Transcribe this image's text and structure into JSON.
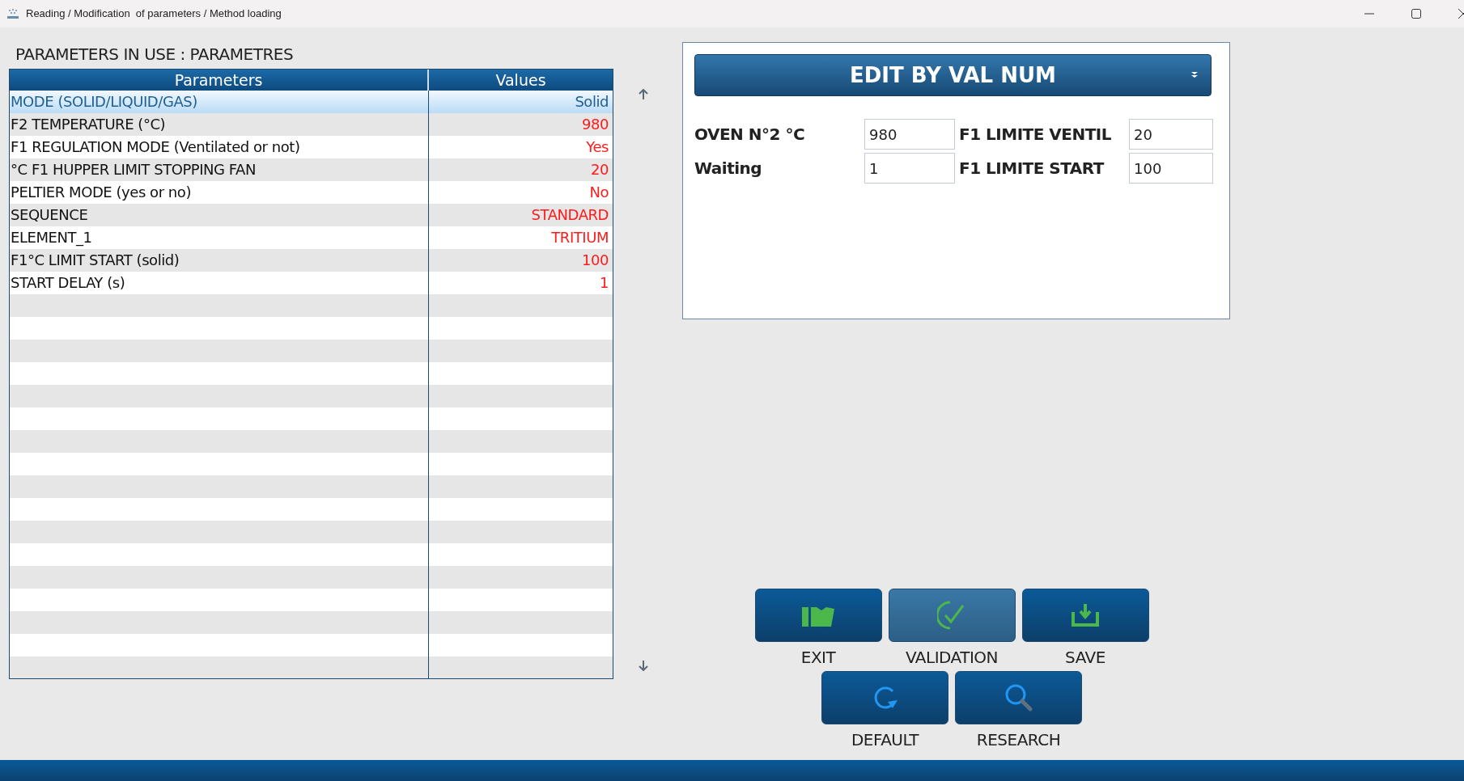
{
  "window": {
    "title": "Reading / Modification  of parameters / Method loading"
  },
  "heading": "PARAMETERS IN USE : PARAMETRES",
  "table": {
    "columns": [
      "Parameters",
      "Values"
    ],
    "rows": [
      {
        "parameter": "MODE (SOLID/LIQUID/GAS)",
        "value": "Solid",
        "selected": true
      },
      {
        "parameter": "F2 TEMPERATURE (°C)",
        "value": "980",
        "selected": false
      },
      {
        "parameter": "F1 REGULATION MODE (Ventilated or not)",
        "value": "Yes",
        "selected": false
      },
      {
        "parameter": "°C F1 HUPPER LIMIT STOPPING FAN",
        "value": "20",
        "selected": false
      },
      {
        "parameter": "PELTIER MODE (yes or no)",
        "value": "No",
        "selected": false
      },
      {
        "parameter": "SEQUENCE",
        "value": "STANDARD",
        "selected": false
      },
      {
        "parameter": "ELEMENT_1",
        "value": "TRITIUM",
        "selected": false
      },
      {
        "parameter": "F1°C LIMIT START (solid)",
        "value": "100",
        "selected": false
      },
      {
        "parameter": "START DELAY (s)",
        "value": "1",
        "selected": false
      }
    ]
  },
  "editor": {
    "mode": "EDIT BY VAL NUM",
    "fields": [
      {
        "label": "OVEN N°2 °C",
        "value": "980"
      },
      {
        "label": "F1 LIMITE VENTIL",
        "value": "20"
      },
      {
        "label": "Waiting",
        "value": "1"
      },
      {
        "label": "F1 LIMITE START",
        "value": "100"
      }
    ]
  },
  "buttons": [
    {
      "kind": "exit",
      "label": "EXIT",
      "active": false
    },
    {
      "kind": "validation",
      "label": "VALIDATION",
      "active": true
    },
    {
      "kind": "save",
      "label": "SAVE",
      "active": false
    },
    {
      "kind": "default",
      "label": "DEFAULT",
      "active": false
    },
    {
      "kind": "research",
      "label": "RESEARCH",
      "active": false
    }
  ]
}
